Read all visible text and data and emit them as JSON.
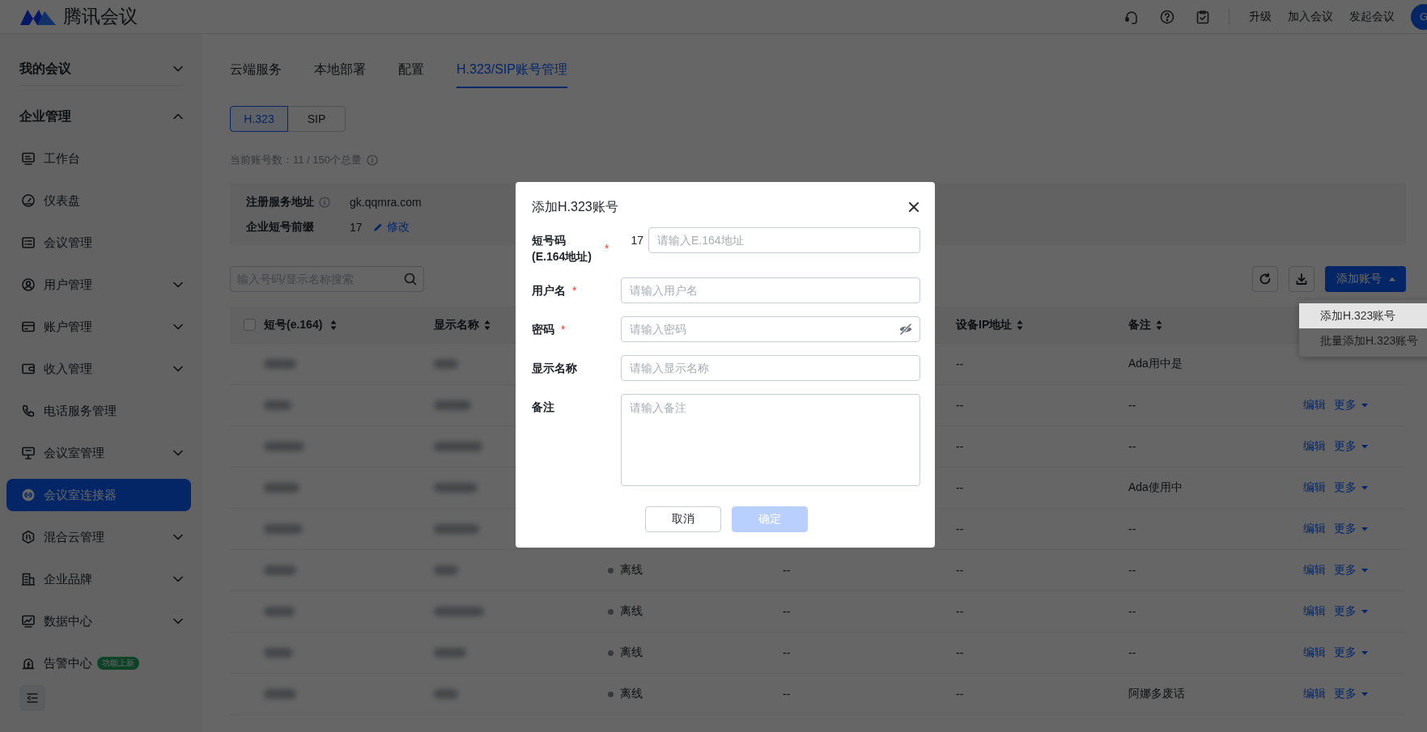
{
  "app": {
    "title": "腾讯会议",
    "actions": [
      "升级",
      "加入会议",
      "发起会议"
    ],
    "avatar": "G"
  },
  "sidebar": {
    "groups": [
      {
        "label": "我的会议",
        "expanded": false
      },
      {
        "label": "企业管理",
        "expanded": true,
        "items": [
          {
            "label": "工作台",
            "selected": false
          },
          {
            "label": "仪表盘",
            "selected": false
          },
          {
            "label": "会议管理",
            "selected": false
          },
          {
            "label": "用户管理",
            "selected": false,
            "expanded": false
          },
          {
            "label": "账户管理",
            "selected": false,
            "expanded": false
          },
          {
            "label": "收入管理",
            "selected": false,
            "expanded": false
          },
          {
            "label": "电话服务管理",
            "selected": false
          },
          {
            "label": "会议室管理",
            "selected": false,
            "expanded": false
          },
          {
            "label": "会议室连接器",
            "selected": true
          },
          {
            "label": "混合云管理",
            "selected": false,
            "expanded": false
          },
          {
            "label": "企业品牌",
            "selected": false,
            "expanded": false
          },
          {
            "label": "数据中心",
            "selected": false,
            "expanded": false
          },
          {
            "label": "告警中心",
            "selected": false,
            "badge": "功能上新"
          }
        ]
      }
    ]
  },
  "tabs": [
    {
      "label": "云端服务",
      "selected": false
    },
    {
      "label": "本地部署",
      "selected": false
    },
    {
      "label": "配置",
      "selected": false
    },
    {
      "label": "H.323/SIP账号管理",
      "selected": true
    }
  ],
  "segments": [
    {
      "label": "H.323",
      "selected": true
    },
    {
      "label": "SIP",
      "selected": false
    }
  ],
  "account_count": "当前账号数：11 / 150个总量",
  "info": [
    {
      "label": "注册服务地址",
      "value": "gk.qqmra.com",
      "kind": "info"
    },
    {
      "label": "企业短号前缀",
      "value": "17",
      "kind": "editable",
      "action": "修改"
    }
  ],
  "search": {
    "placeholder": "输入号码/显示名称搜索"
  },
  "add_button": {
    "label": "添加账号",
    "expanded": true
  },
  "add_menu": [
    {
      "label": "添加H.323账号",
      "hovered": true
    },
    {
      "label": "批量添加H.323账号",
      "hovered": false
    }
  ],
  "table": {
    "select_all": {
      "checked": false
    },
    "columns": [
      {
        "label": "短号(e.164)",
        "sortable": true
      },
      {
        "label": "显示名称",
        "sortable": true
      },
      {
        "label": "设备IP地址",
        "sortable": true
      },
      {
        "label": "备注",
        "sortable": true
      }
    ],
    "rows": [
      {
        "ip": "--",
        "note": "Ada用中是"
      },
      {
        "ip": "--",
        "note": "--",
        "actions": [
          "编辑",
          "更多"
        ]
      },
      {
        "ip": "--",
        "note": "--",
        "actions": [
          "编辑",
          "更多"
        ]
      },
      {
        "ip": "--",
        "note": "Ada使用中",
        "actions": [
          "编辑",
          "更多"
        ]
      },
      {
        "ip": "--",
        "note": "--",
        "actions": [
          "编辑",
          "更多"
        ]
      },
      {
        "status": "离线",
        "column_5": "--",
        "ip": "--",
        "note": "--",
        "actions": [
          "编辑",
          "更多"
        ]
      },
      {
        "status": "离线",
        "column_5": "--",
        "ip": "--",
        "note": "--",
        "actions": [
          "编辑",
          "更多"
        ]
      },
      {
        "status": "离线",
        "column_5": "--",
        "ip": "--",
        "note": "--",
        "actions": [
          "编辑",
          "更多"
        ]
      },
      {
        "status": "离线",
        "column_5": "--",
        "ip": "--",
        "note": "阿娜多废话",
        "actions": [
          "编辑",
          "更多"
        ]
      }
    ]
  },
  "dialog": {
    "title": "添加H.323账号",
    "fields": [
      {
        "label": "短号码 (E.164地址)",
        "required_mark": "*",
        "prefix": "17",
        "placeholder": "请输入E.164地址",
        "kind": "text"
      },
      {
        "label": "用户名",
        "required_mark": "*",
        "placeholder": "请输入用户名",
        "kind": "text"
      },
      {
        "label": "密码",
        "required_mark": "*",
        "placeholder": "请输入密码",
        "kind": "password"
      },
      {
        "label": "显示名称",
        "placeholder": "请输入显示名称",
        "kind": "text"
      },
      {
        "label": "备注",
        "placeholder": "请输入备注",
        "kind": "textarea"
      }
    ],
    "buttons": [
      {
        "label": "取消",
        "kind": "secondary",
        "disabled": false
      },
      {
        "label": "确定",
        "kind": "primary",
        "disabled": true
      }
    ]
  }
}
